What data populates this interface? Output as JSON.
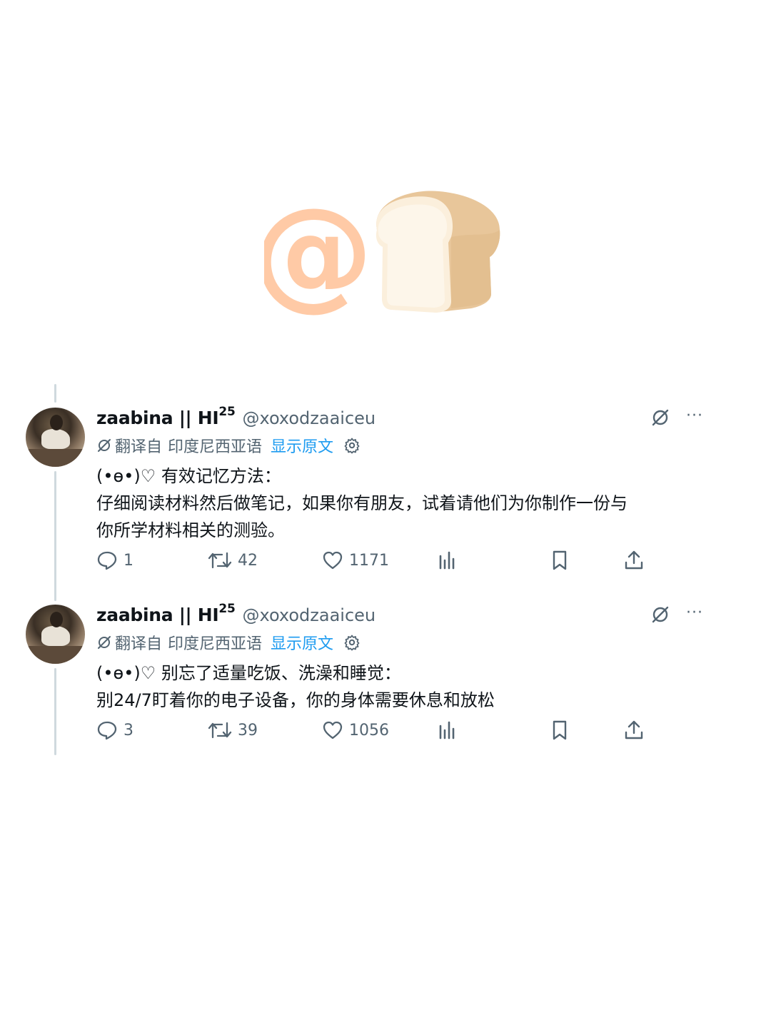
{
  "tweets": [
    {
      "display_name": "zaabina || HI",
      "name_sup": "25",
      "handle": "@xoxodzaaiceu",
      "translated_from_label": "翻译自",
      "source_language": "印度尼西亚语",
      "show_original": "显示原文",
      "lines": [
        "(•ɵ•)♡ 有效记忆方法：",
        "仔细阅读材料然后做笔记，如果你有朋友，试着请他们为你制作一份与",
        "你所学材料相关的测验。"
      ],
      "replies": "1",
      "retweets": "42",
      "likes": "1171"
    },
    {
      "display_name": "zaabina || HI",
      "name_sup": "25",
      "handle": "@xoxodzaaiceu",
      "translated_from_label": "翻译自",
      "source_language": "印度尼西亚语",
      "show_original": "显示原文",
      "lines": [
        "(•ɵ•)♡ 别忘了适量吃饭、洗澡和睡觉：",
        "别24/7盯着你的电子设备，你的身体需要休息和放松"
      ],
      "replies": "3",
      "retweets": "39",
      "likes": "1056"
    }
  ],
  "icons": {
    "header_left": "at-sign-emoji",
    "header_right": "bread-emoji",
    "translate": "translate-icon",
    "settings": "gear-icon",
    "more": "more-icon",
    "reply": "reply-icon",
    "retweet": "retweet-icon",
    "like": "heart-icon",
    "views": "analytics-icon",
    "bookmark": "bookmark-icon",
    "share": "share-icon"
  },
  "colors": {
    "link": "#1d9bf0",
    "secondary": "#536471",
    "thread_line": "#cfd9de",
    "at_sign": "#ffcaa6",
    "bread": "#f3dcb8"
  }
}
